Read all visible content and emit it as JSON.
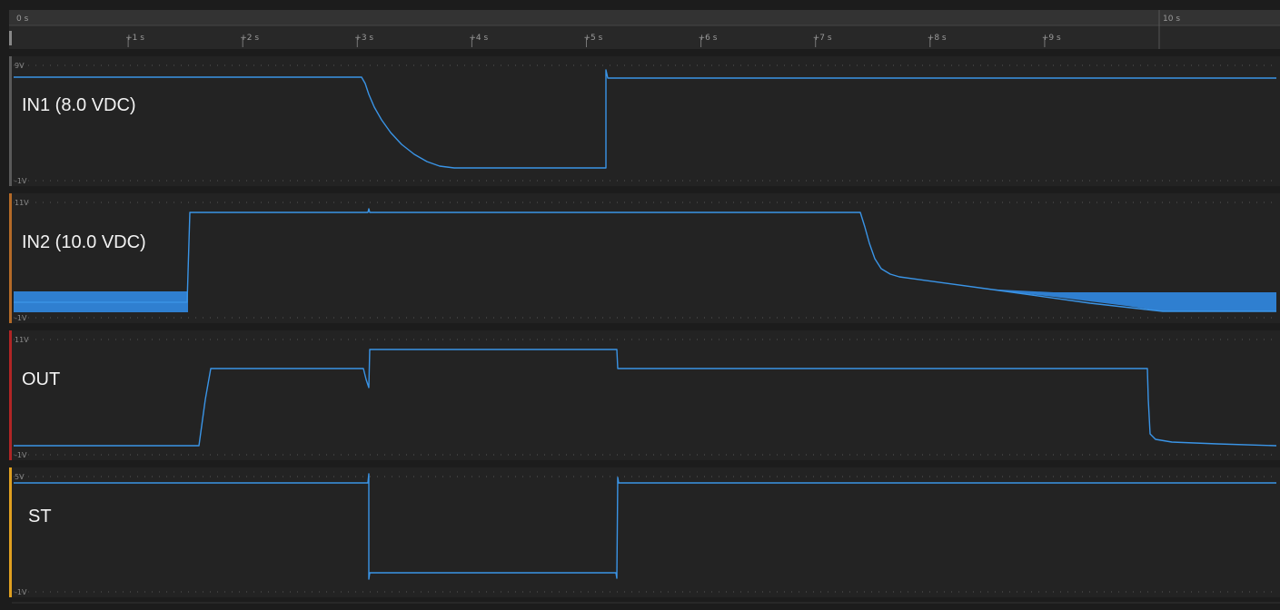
{
  "timeline": {
    "start_label": "0 s",
    "end_label": "10 s",
    "ticks": [
      "+1 s",
      "+2 s",
      "+3 s",
      "+4 s",
      "+5 s",
      "+6 s",
      "+7 s",
      "+8 s",
      "+9 s"
    ]
  },
  "colors": {
    "trace": "#3a94e6",
    "panel_bg": "#232323",
    "ch1_tab": "#5a5a5a",
    "ch2_tab": "#b46a28",
    "ch3_tab": "#b02525",
    "ch4_tab": "#e0a020"
  },
  "channels": [
    {
      "label": "IN1 (8.0 VDC)",
      "top": "9V",
      "bottom": "-1V"
    },
    {
      "label": "IN2 (10.0 VDC)",
      "top": "11V",
      "bottom": "-1V"
    },
    {
      "label": "OUT",
      "top": "11V",
      "bottom": "-1V"
    },
    {
      "label": "ST",
      "top": "5V",
      "bottom": "-1V"
    }
  ]
}
